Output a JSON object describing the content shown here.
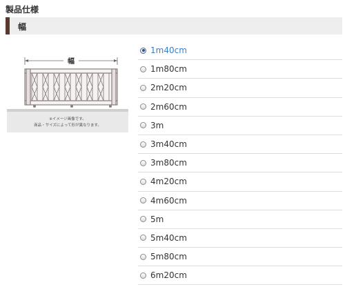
{
  "page": {
    "title": "製品仕様"
  },
  "section": {
    "label": "幅"
  },
  "illustration": {
    "dimension_label": "幅",
    "caption_lines": [
      "※イメージ画像です。",
      "商品・サイズによって形が異なります。"
    ]
  },
  "options": [
    {
      "label": "1m40cm",
      "selected": true
    },
    {
      "label": "1m80cm",
      "selected": false
    },
    {
      "label": "2m20cm",
      "selected": false
    },
    {
      "label": "2m60cm",
      "selected": false
    },
    {
      "label": "3m",
      "selected": false
    },
    {
      "label": "3m40cm",
      "selected": false
    },
    {
      "label": "3m80cm",
      "selected": false
    },
    {
      "label": "4m20cm",
      "selected": false
    },
    {
      "label": "4m60cm",
      "selected": false
    },
    {
      "label": "5m",
      "selected": false
    },
    {
      "label": "5m40cm",
      "selected": false
    },
    {
      "label": "5m80cm",
      "selected": false
    },
    {
      "label": "6m20cm",
      "selected": false
    }
  ],
  "colors": {
    "section_accent": "#5a3a2c",
    "section_background": "#eeeeee",
    "selected_text": "#3a7fc4",
    "gate_metal": "#8a7f80"
  }
}
